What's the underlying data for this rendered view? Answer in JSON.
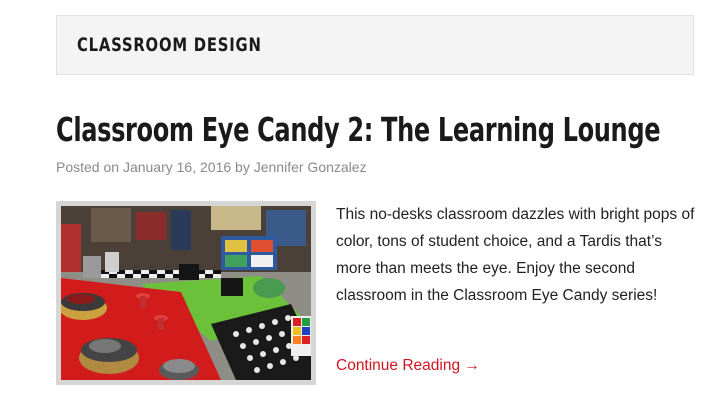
{
  "category": {
    "title": "CLASSROOM DESIGN"
  },
  "post": {
    "title": "Classroom Eye Candy 2: The Learning Lounge",
    "meta": {
      "posted_on_label": "Posted on",
      "date": "January 16, 2016",
      "by_label": "by",
      "author": "Jennifer Gonzalez"
    },
    "excerpt": "This no-desks classroom dazzles with bright pops of color, tons of student choice, and a Tardis that’s more than meets the eye. Enjoy the second classroom in the Classroom Eye Candy series!",
    "continue_label": "Continue Reading →"
  },
  "colors": {
    "accent_link": "#d0171f",
    "meta_text": "#8a8a8a",
    "category_bg": "#f4f4f4"
  }
}
